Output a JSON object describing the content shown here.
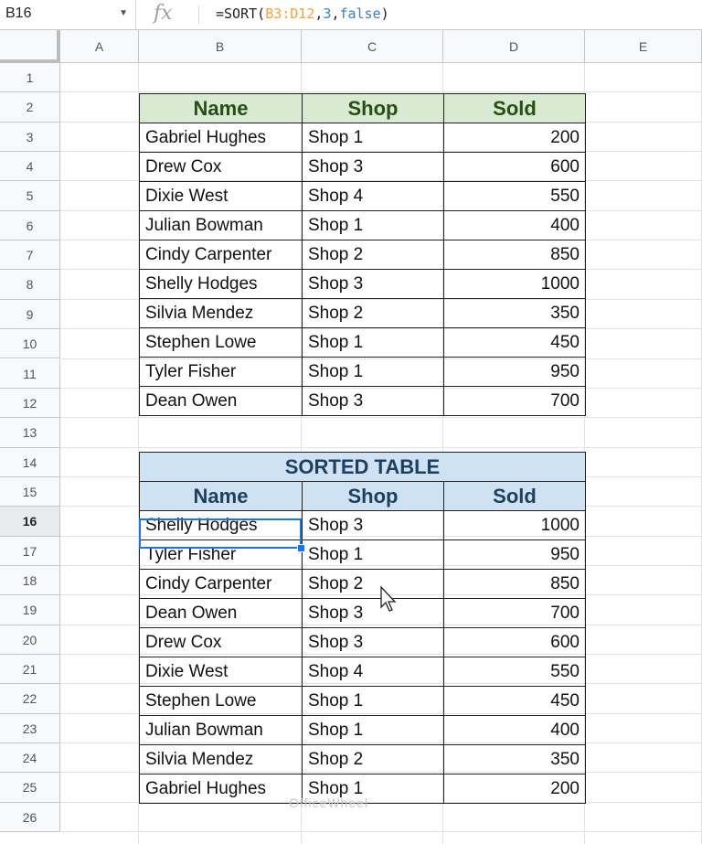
{
  "formula_bar": {
    "cell_ref": "B16",
    "fx": "fx",
    "formula_prefix": "=SORT(",
    "formula_range": "B3:D12",
    "formula_sep1": ",",
    "formula_col": "3",
    "formula_sep2": ",",
    "formula_order": "false",
    "formula_suffix": ")"
  },
  "columns": [
    "A",
    "B",
    "C",
    "D",
    "E"
  ],
  "rows": [
    "1",
    "2",
    "3",
    "4",
    "5",
    "6",
    "7",
    "8",
    "9",
    "10",
    "11",
    "12",
    "13",
    "14",
    "15",
    "16",
    "17",
    "18",
    "19",
    "20",
    "21",
    "22",
    "23",
    "24",
    "25",
    "26"
  ],
  "selected_row": "16",
  "table1": {
    "headers": [
      "Name",
      "Shop",
      "Sold"
    ],
    "rows": [
      [
        "Gabriel Hughes",
        "Shop 1",
        "200"
      ],
      [
        "Drew Cox",
        "Shop 3",
        "600"
      ],
      [
        "Dixie West",
        "Shop 4",
        "550"
      ],
      [
        "Julian Bowman",
        "Shop 1",
        "400"
      ],
      [
        "Cindy Carpenter",
        "Shop 2",
        "850"
      ],
      [
        "Shelly Hodges",
        "Shop 3",
        "1000"
      ],
      [
        "Silvia Mendez",
        "Shop 2",
        "350"
      ],
      [
        "Stephen Lowe",
        "Shop 1",
        "450"
      ],
      [
        "Tyler Fisher",
        "Shop 1",
        "950"
      ],
      [
        "Dean Owen",
        "Shop 3",
        "700"
      ]
    ]
  },
  "table2": {
    "title": "SORTED TABLE",
    "headers": [
      "Name",
      "Shop",
      "Sold"
    ],
    "rows": [
      [
        "Shelly Hodges",
        "Shop 3",
        "1000"
      ],
      [
        "Tyler Fisher",
        "Shop 1",
        "950"
      ],
      [
        "Cindy Carpenter",
        "Shop 2",
        "850"
      ],
      [
        "Dean Owen",
        "Shop 3",
        "700"
      ],
      [
        "Drew Cox",
        "Shop 3",
        "600"
      ],
      [
        "Dixie West",
        "Shop 4",
        "550"
      ],
      [
        "Stephen Lowe",
        "Shop 1",
        "450"
      ],
      [
        "Julian Bowman",
        "Shop 1",
        "400"
      ],
      [
        "Silvia Mendez",
        "Shop 2",
        "350"
      ],
      [
        "Gabriel Hughes",
        "Shop 1",
        "200"
      ]
    ]
  },
  "watermark": "OfficeWheel",
  "colors": {
    "header1_bg": "#d9ead3",
    "header1_text": "#274e13",
    "header2_bg": "#cfe2f3",
    "header2_text": "#1f3f5e",
    "selection": "#1a73e8"
  }
}
